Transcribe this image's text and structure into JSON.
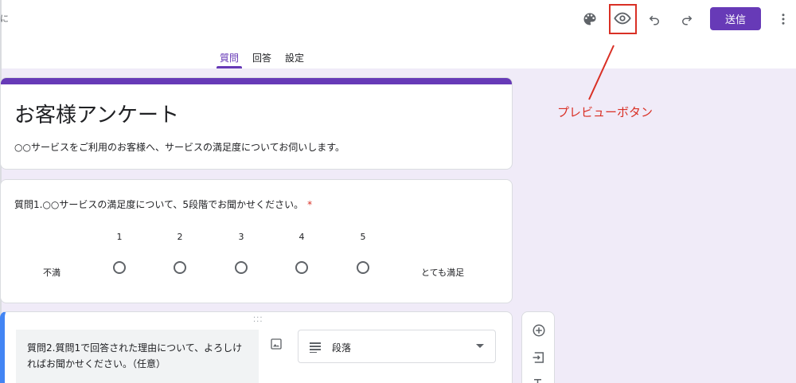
{
  "topbar": {
    "cropped_char": "に",
    "send_label": "送信",
    "icons": {
      "palette": "palette-icon",
      "preview": "eye-icon",
      "undo": "undo-icon",
      "redo": "redo-icon",
      "more": "more-vertical-icon"
    }
  },
  "tabs": [
    {
      "label": "質問",
      "active": true
    },
    {
      "label": "回答",
      "active": false
    },
    {
      "label": "設定",
      "active": false
    }
  ],
  "annotation": {
    "text": "プレビューボタン",
    "color": "#d93025"
  },
  "form": {
    "title": "お客様アンケート",
    "description": "○○サービスをご利用のお客様へ、サービスの満足度についてお伺いします。"
  },
  "question1": {
    "title": "質問1.○○サービスの満足度について、5段階でお聞かせください。",
    "required_mark": "*",
    "scale": [
      "1",
      "2",
      "3",
      "4",
      "5"
    ],
    "low_label": "不満",
    "high_label": "とても満足"
  },
  "question2": {
    "title": "質問2.質問1で回答された理由について、よろしければお聞かせください。（任意）",
    "type_label": "段落"
  },
  "colors": {
    "accent": "#673ab7",
    "background": "#f0ebf8",
    "annotation": "#d93025",
    "focus": "#4285f4"
  }
}
